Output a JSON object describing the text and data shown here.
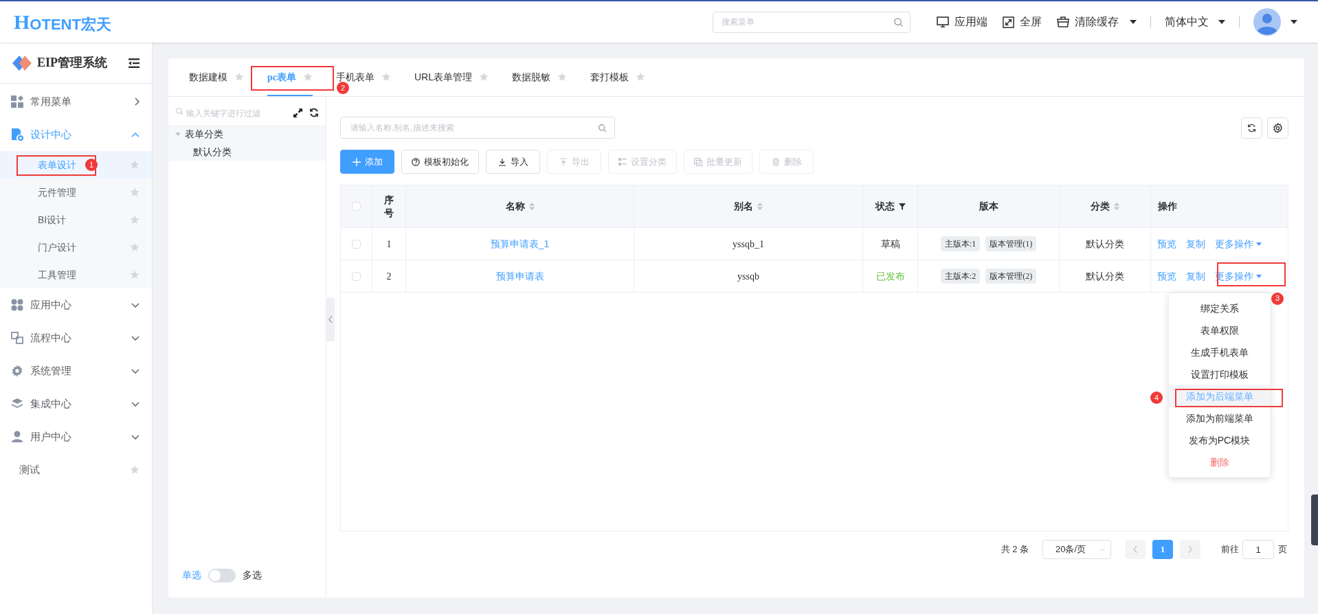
{
  "header": {
    "logo_mark": "H",
    "logo_text": "OTENT宏天",
    "search": {
      "placeholder": "搜索菜单"
    },
    "actions": [
      {
        "label": "应用端",
        "caret": false
      },
      {
        "label": "全屏",
        "caret": false
      },
      {
        "label": "清除缓存",
        "caret": true
      }
    ],
    "language": "简体中文"
  },
  "sidebar": {
    "title": "EIP管理系统",
    "items": [
      {
        "label": "常用菜单",
        "kind": "group",
        "expanded": false
      },
      {
        "label": "设计中心",
        "kind": "group",
        "expanded": true,
        "children": [
          {
            "label": "表单设计",
            "selected": true,
            "annotation": "1"
          },
          {
            "label": "元件管理",
            "selected": false
          },
          {
            "label": "BI设计",
            "selected": false
          },
          {
            "label": "门户设计",
            "selected": false
          },
          {
            "label": "工具管理",
            "selected": false
          }
        ]
      },
      {
        "label": "应用中心",
        "kind": "group",
        "expanded": false
      },
      {
        "label": "流程中心",
        "kind": "group",
        "expanded": false
      },
      {
        "label": "系统管理",
        "kind": "group",
        "expanded": false
      },
      {
        "label": "集成中心",
        "kind": "group",
        "expanded": false
      },
      {
        "label": "用户中心",
        "kind": "group",
        "expanded": false
      },
      {
        "label": "测试",
        "kind": "link"
      }
    ]
  },
  "tabs": [
    {
      "label": "数据建模",
      "selected": false
    },
    {
      "label": "pc表单",
      "selected": true,
      "annotation": "2"
    },
    {
      "label": "手机表单",
      "selected": false
    },
    {
      "label": "URL表单管理",
      "selected": false
    },
    {
      "label": "数据脱敏",
      "selected": false
    },
    {
      "label": "套打模板",
      "selected": false
    }
  ],
  "tree": {
    "filter": {
      "placeholder": "输入关键字进行过滤"
    },
    "nodes": [
      {
        "label": "表单分类",
        "expanded": true,
        "children": [
          {
            "label": "默认分类"
          }
        ]
      }
    ],
    "select_mode": {
      "left": "单选",
      "right": "多选",
      "on": false
    }
  },
  "toolbar": {
    "search": {
      "placeholder": "请输入名称,别名,描述来搜索"
    },
    "buttons": [
      {
        "label": "添加",
        "kind": "primary",
        "disabled": false
      },
      {
        "label": "模板初始化",
        "kind": "help",
        "disabled": false
      },
      {
        "label": "导入",
        "kind": "import",
        "disabled": false
      },
      {
        "label": "导出",
        "kind": "export",
        "disabled": true
      },
      {
        "label": "设置分类",
        "kind": "category",
        "disabled": true
      },
      {
        "label": "批量更新",
        "kind": "update",
        "disabled": true
      },
      {
        "label": "删除",
        "kind": "delete",
        "disabled": true
      }
    ]
  },
  "table": {
    "all_checked": false,
    "columns": [
      {
        "label": "序号"
      },
      {
        "label": "名称",
        "sortable": true
      },
      {
        "label": "别名",
        "sortable": true
      },
      {
        "label": "状态",
        "filter": true
      },
      {
        "label": "版本"
      },
      {
        "label": "分类",
        "sortable": true
      },
      {
        "label": "操作"
      }
    ],
    "rows": [
      {
        "index": "1",
        "name": "预算申请表_1",
        "alias": "yssqb_1",
        "status": "草稿",
        "published": false,
        "versions": [
          "主版本:1",
          "版本管理(1)"
        ],
        "category": "默认分类",
        "actions": [
          "预览",
          "复制",
          "更多操作"
        ],
        "checked": false
      },
      {
        "index": "2",
        "name": "预算申请表",
        "alias": "yssqb",
        "status": "已发布",
        "published": true,
        "versions": [
          "主版本:2",
          "版本管理(2)"
        ],
        "category": "默认分类",
        "actions": [
          "预览",
          "复制",
          "更多操作"
        ],
        "checked": false,
        "annotation": "3"
      }
    ]
  },
  "dropdown": {
    "items": [
      {
        "label": "绑定关系",
        "kind": "normal",
        "highlighted": false
      },
      {
        "label": "表单权限",
        "kind": "normal",
        "highlighted": false
      },
      {
        "label": "生成手机表单",
        "kind": "normal",
        "highlighted": false
      },
      {
        "label": "设置打印模板",
        "kind": "normal",
        "highlighted": false
      },
      {
        "label": "添加为后端菜单",
        "kind": "normal",
        "highlighted": true,
        "annotation": "4"
      },
      {
        "label": "添加为前端菜单",
        "kind": "normal",
        "highlighted": false
      },
      {
        "label": "发布为PC模块",
        "kind": "normal",
        "highlighted": false
      },
      {
        "label": "删除",
        "kind": "danger",
        "highlighted": false
      }
    ]
  },
  "pagination": {
    "total": "共 2 条",
    "page_size": "20条/页",
    "pages": [
      {
        "label": "1",
        "selected": true
      }
    ],
    "goto_label": "前往",
    "goto_value": "1",
    "goto_unit": "页"
  }
}
